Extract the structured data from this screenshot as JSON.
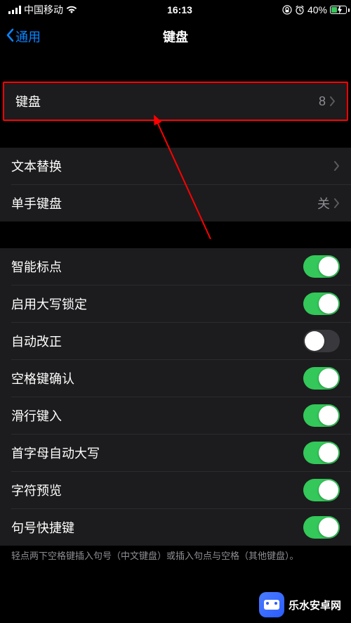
{
  "status": {
    "carrier": "中国移动",
    "time": "16:13",
    "battery_percent": "40%",
    "battery_fill_width": "40%"
  },
  "nav": {
    "back_label": "通用",
    "title": "键盘"
  },
  "section_keyboards": {
    "label": "键盘",
    "value": "8"
  },
  "section_text": {
    "text_replacement": {
      "label": "文本替换"
    },
    "one_handed": {
      "label": "单手键盘",
      "value": "关"
    }
  },
  "toggles": [
    {
      "key": "smart_punctuation",
      "label": "智能标点",
      "on": true
    },
    {
      "key": "caps_lock",
      "label": "启用大写锁定",
      "on": true
    },
    {
      "key": "auto_correction",
      "label": "自动改正",
      "on": false
    },
    {
      "key": "space_confirm",
      "label": "空格键确认",
      "on": true
    },
    {
      "key": "slide_to_type",
      "label": "滑行键入",
      "on": true
    },
    {
      "key": "auto_capitalization",
      "label": "首字母自动大写",
      "on": true
    },
    {
      "key": "character_preview",
      "label": "字符预览",
      "on": true
    },
    {
      "key": "period_shortcut",
      "label": "句号快捷键",
      "on": true
    }
  ],
  "footer": "轻点两下空格键插入句号（中文键盘）或插入句点与空格（其他键盘）。",
  "watermark": "乐水安卓网",
  "colors": {
    "accent_blue": "#0A84FF",
    "toggle_green": "#34C759",
    "cell_bg": "#1C1C1E",
    "highlight_red": "#FF0000"
  }
}
